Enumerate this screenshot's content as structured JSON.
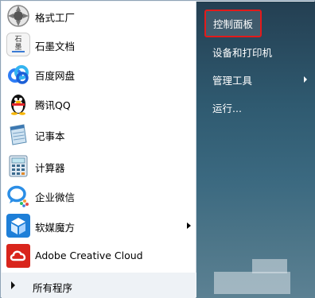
{
  "programs": [
    {
      "label": "格式工厂"
    },
    {
      "label": "石墨文档",
      "icon_text": "石墨"
    },
    {
      "label": "百度网盘"
    },
    {
      "label": "腾讯QQ"
    },
    {
      "label": "记事本"
    },
    {
      "label": "计算器"
    },
    {
      "label": "企业微信"
    },
    {
      "label": "软媒魔方",
      "has_submenu": true
    },
    {
      "label": "Adobe Creative Cloud"
    }
  ],
  "all_programs": {
    "label": "所有程序"
  },
  "right_items": [
    {
      "label": "控制面板",
      "highlighted": true
    },
    {
      "label": "设备和打印机"
    },
    {
      "label": "管理工具",
      "has_submenu": true
    },
    {
      "label": "运行..."
    }
  ],
  "colors": {
    "highlight_border": "#e41a1a",
    "right_pane": "#2f5a70"
  }
}
